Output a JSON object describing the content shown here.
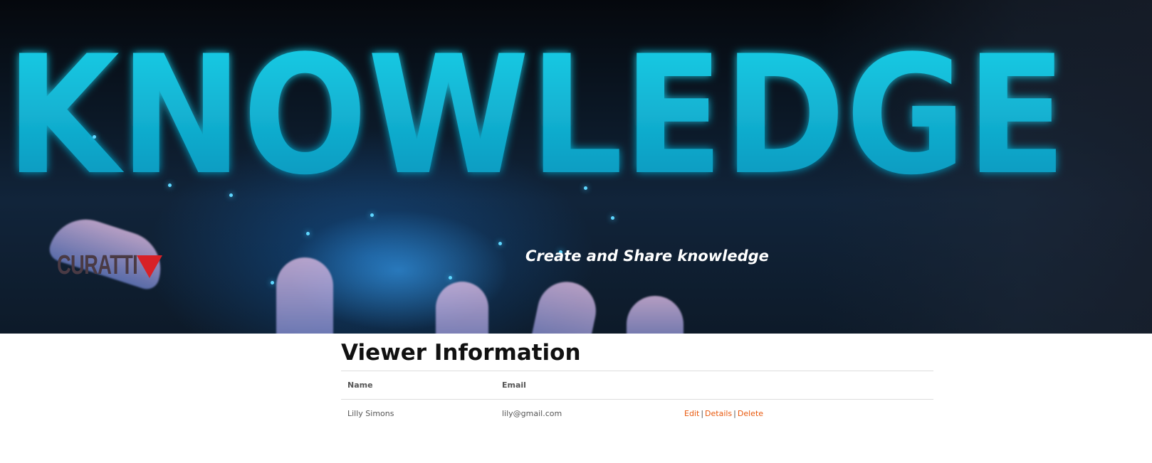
{
  "hero": {
    "word": "KNOWLEDGE",
    "tagline": "Create and Share knowledge",
    "logo_text": "CURATTI",
    "colors": {
      "word": "#10c8e0",
      "logo_accent": "#d82127"
    }
  },
  "main": {
    "title": "Viewer Information",
    "table": {
      "headers": [
        "Name",
        "Email",
        ""
      ],
      "rows": [
        {
          "name": "Lilly Simons",
          "email": "lily@gmail.com",
          "actions": {
            "edit": "Edit",
            "details": "Details",
            "delete": "Delete",
            "separator": "|"
          }
        }
      ]
    },
    "colors": {
      "link": "#e8580c"
    }
  }
}
